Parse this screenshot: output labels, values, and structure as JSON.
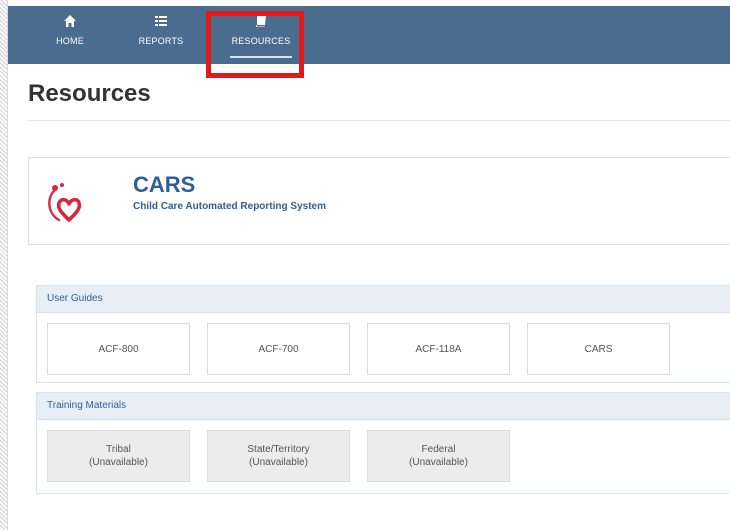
{
  "nav": {
    "items": [
      {
        "label": "HOME",
        "icon": "home-icon"
      },
      {
        "label": "REPORTS",
        "icon": "list-icon"
      },
      {
        "label": "RESOURCES",
        "icon": "book-icon",
        "active": true
      }
    ],
    "background": "#4a6c8f",
    "highlight_color": "#e01b1b"
  },
  "page": {
    "title": "Resources"
  },
  "app": {
    "name": "CARS",
    "subtitle": "Child Care Automated Reporting System",
    "logo": "heart-stethoscope-logo"
  },
  "user_guides": {
    "header": "User Guides",
    "items": [
      "ACF-800",
      "ACF-700",
      "ACF-118A",
      "CARS"
    ]
  },
  "training": {
    "header": "Training Materials",
    "items": [
      {
        "name": "Tribal",
        "status": "(Unavailable)"
      },
      {
        "name": "State/Territory",
        "status": "(Unavailable)"
      },
      {
        "name": "Federal",
        "status": "(Unavailable)"
      }
    ]
  }
}
